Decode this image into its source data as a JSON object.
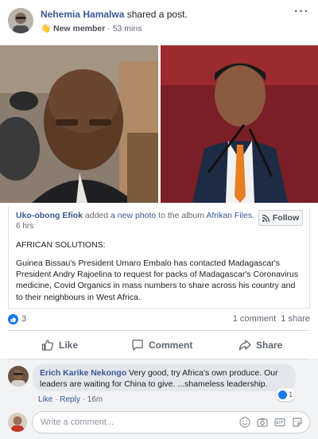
{
  "post": {
    "author": "Nehemia Hamalwa",
    "action": " shared a post.",
    "badge": "New member",
    "time": " · 53 mins",
    "more_icon": "more-horizontal-icon"
  },
  "shared": {
    "author": "Uko-obong Efiok",
    "added": " added ",
    "photo_link": "a new photo",
    "album_pre": " to the album ",
    "album": "Afrikan Files",
    "album_post": ".",
    "time": "6 hrs",
    "follow_label": "Follow",
    "title": "AFRICAN SOLUTIONS:",
    "body": "Guinea Bissau's President Umaro Embalo has contacted Madagascar's President Andry Rajoelina to request for packs of Madagascar's Coronavirus medicine, Covid Organics in mass numbers to share across his country and to their neighbours in West Africa."
  },
  "stats": {
    "reactions": "3",
    "comments": "1 comment",
    "shares": "1 share"
  },
  "actions": {
    "like": "Like",
    "comment": "Comment",
    "share": "Share"
  },
  "comment": {
    "author": "Erich Karike Nekongo",
    "text": " Very good, try Africa's own produce. Our leaders are waiting for China to give. ...shameless leadership.",
    "reaction_count": "1",
    "like": "Like",
    "sep1": " · ",
    "reply": "Reply",
    "sep2": " · ",
    "time": "16m"
  },
  "write_comment": {
    "placeholder": "Write a comment...",
    "icons": [
      "emoji-icon",
      "camera-icon",
      "gif-icon",
      "sticker-icon"
    ]
  },
  "colors": {
    "link": "#385898",
    "accent": "#1877f2",
    "meta": "#606770",
    "comment_bg": "#f2f3f5"
  }
}
